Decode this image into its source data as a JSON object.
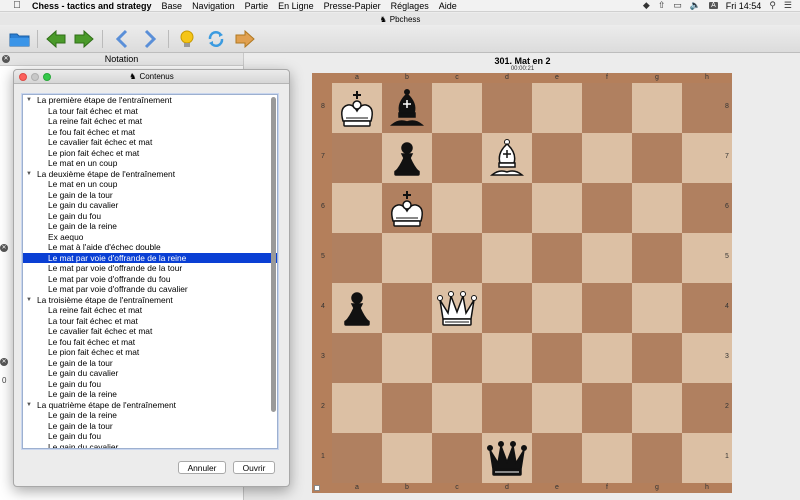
{
  "menubar": {
    "app_name": "Chess - tactics and strategy",
    "items": [
      "Base",
      "Navigation",
      "Partie",
      "En Ligne",
      "Presse-Papier",
      "Réglages",
      "Aide"
    ],
    "time": "Fri 14:54",
    "input_source": "A"
  },
  "window": {
    "title": "Pbchess"
  },
  "notation": {
    "title": "Notation",
    "side_digit": "0"
  },
  "puzzle": {
    "title": "301. Mat en 2",
    "timer": "00:00:21"
  },
  "board": {
    "files": [
      "a",
      "b",
      "c",
      "d",
      "e",
      "f",
      "g",
      "h"
    ],
    "ranks": [
      "8",
      "7",
      "6",
      "5",
      "4",
      "3",
      "2",
      "1"
    ],
    "pieces": [
      {
        "square": "a8",
        "piece": "king",
        "color": "white"
      },
      {
        "square": "b8",
        "piece": "bishop",
        "color": "black"
      },
      {
        "square": "b7",
        "piece": "pawn",
        "color": "black"
      },
      {
        "square": "d7",
        "piece": "bishop",
        "color": "white"
      },
      {
        "square": "b6",
        "piece": "king",
        "color": "white"
      },
      {
        "square": "a4",
        "piece": "pawn",
        "color": "black"
      },
      {
        "square": "c4",
        "piece": "queen",
        "color": "white"
      },
      {
        "square": "d1",
        "piece": "queen",
        "color": "black"
      }
    ]
  },
  "dialog": {
    "title": "Contenus",
    "groups": [
      {
        "label": "La première étape de l'entraînement",
        "items": [
          "La tour fait échec et mat",
          "La reine fait échec et mat",
          "Le fou fait échec et mat",
          "Le cavalier fait échec et mat",
          "Le pion fait échec et mat",
          "Le mat en un coup"
        ]
      },
      {
        "label": "La deuxième étape de l'entraînement",
        "items": [
          "Le mat en un coup",
          "Le gain de la tour",
          "Le gain du cavalier",
          "Le gain du fou",
          "Le gain de la reine",
          "Ex aequo",
          "Le mat à l'aide d'échec double",
          "Le mat par voie d'offrande de la reine",
          "Le mat par voie d'offrande de la tour",
          "Le mat par voie d'offrande du fou",
          "Le mat par voie d'offrande du cavalier"
        ]
      },
      {
        "label": "La troisième étape de l'entraînement",
        "items": [
          "La reine fait échec et mat",
          "La tour fait échec et mat",
          "Le cavalier fait échec et mat",
          "Le fou fait échec et mat",
          "Le pion fait échec et mat",
          "Le gain de la tour",
          "Le gain du cavalier",
          "Le gain du fou",
          "Le gain de la reine"
        ]
      },
      {
        "label": "La quatrième étape de l'entraînement",
        "items": [
          "Le gain de la reine",
          "Le gain de la tour",
          "Le gain du fou",
          "Le gain du cavalier"
        ]
      }
    ],
    "selected": "Le mat par voie d'offrande de la reine",
    "cancel_label": "Annuler",
    "open_label": "Ouvrir"
  },
  "colors": {
    "light_square": "#dcc0a4",
    "dark_square": "#b08060",
    "selection": "#0a3fd4",
    "board_frame": "#b47f5b"
  }
}
